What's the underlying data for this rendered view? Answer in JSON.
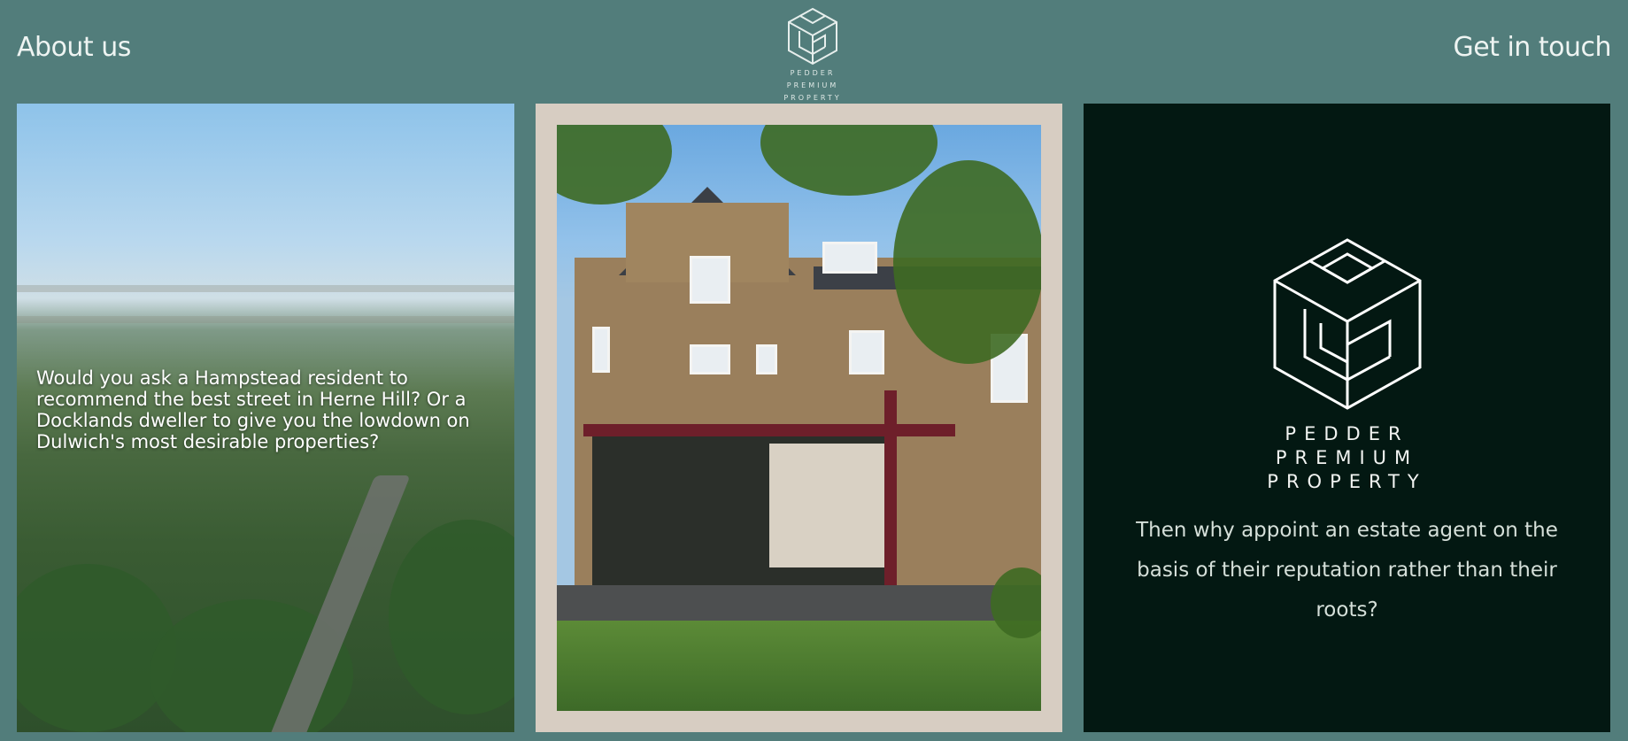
{
  "nav": {
    "about_label": "About us",
    "contact_label": "Get in touch"
  },
  "logo": {
    "icon": "interlocking-cube-logo-icon",
    "line1": "PEDDER",
    "line2": "PREMIUM",
    "line3": "PROPERTY"
  },
  "panels": {
    "aerial": {
      "image": "aerial-view-of-suburban-london-photo",
      "text": "Would you ask a Hampstead resident to recommend the best street in Herne Hill? Or a Docklands dweller to give you the lowdown on Dulwich's most desirable properties?"
    },
    "house": {
      "image": "brick-victorian-house-rear-extension-photo"
    },
    "brand": {
      "logo_line1": "PEDDER",
      "logo_line2": "PREMIUM",
      "logo_line3": "PROPERTY",
      "text": "Then why appoint an estate agent on the basis of their reputation rather than their roots?"
    }
  },
  "colors": {
    "page_background": "#527d7b",
    "brand_panel": "#031812",
    "photo_frame": "#d7cdc2",
    "text_light": "#eef4f2"
  }
}
